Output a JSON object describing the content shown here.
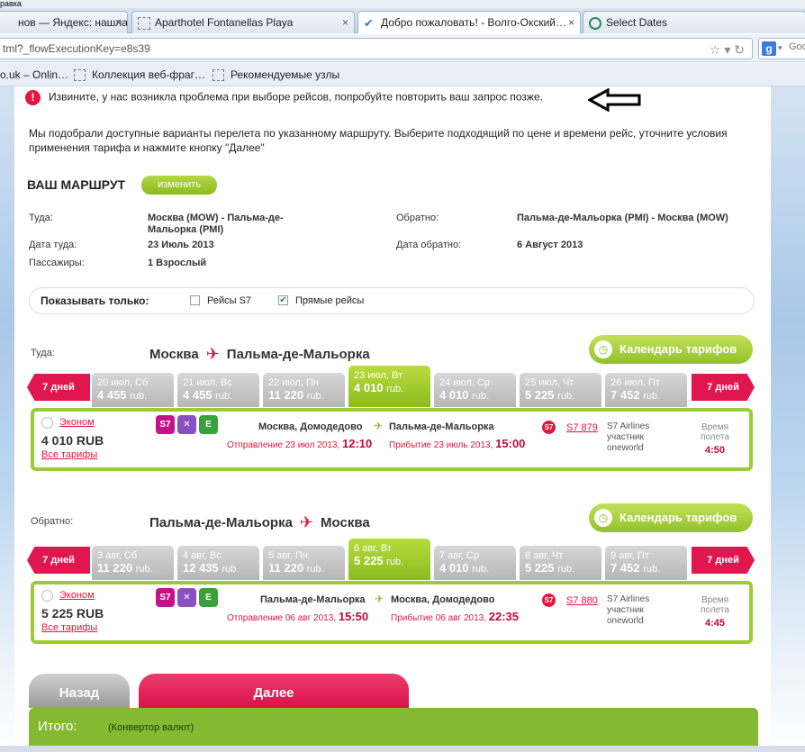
{
  "browser": {
    "menu_fragment": "равка",
    "tabs": [
      {
        "label": "нов — Яндекс: нашла…",
        "icon": "yandex-icon"
      },
      {
        "label": "Aparthotel Fontanellas Playa",
        "icon": "page-icon"
      },
      {
        "label": "Добро пожаловать! - Волго-Окский…",
        "icon": "checkmark-icon"
      },
      {
        "label": "Select Dates",
        "icon": "tripadvisor-icon"
      }
    ],
    "url": "tml?_flowExecutionKey=e8s39",
    "search_engine_label": "Goo",
    "bookmarks": [
      "o.uk – Onlin…",
      "Коллекция веб-фраг…",
      "Рекомендуемые узлы"
    ]
  },
  "page": {
    "error_message": "Извините, у нас возникла проблема при выборе рейсов, попробуйте повторить ваш запрос позже.",
    "intro": "Мы подобрали доступные варианты перелета по указанному маршруту. Выберите подходящий по цене и времени рейс, уточните условия применения тарифа и нажмите кнопку \"Далее\"",
    "route_heading": "ВАШ МАРШРУТ",
    "change_label": "изменить",
    "route": {
      "outbound_label": "Туда:",
      "outbound_value": "Москва (MOW) - Пальма-де-Мальорка (PMI)",
      "return_label": "Обратно:",
      "return_value": "Пальма-де-Мальорка (PMI) - Москва (MOW)",
      "outbound_date_label": "Дата туда:",
      "outbound_date": "23 Июль 2013",
      "return_date_label": "Дата обратно:",
      "return_date": "6 Август 2013",
      "passengers_label": "Пассажиры:",
      "passengers": "1 Взрослый"
    },
    "filter": {
      "heading": "Показывать только:",
      "s7_only": "Рейсы S7",
      "s7_checked": false,
      "direct_only": "Прямые рейсы",
      "direct_checked": true
    },
    "calendar_label": "Календарь тарифов",
    "nav_label": "7 дней",
    "outbound": {
      "section_label": "Туда:",
      "from": "Москва",
      "to": "Пальма-де-Мальорка",
      "days": [
        {
          "date": "20 июл, Сб",
          "price": "4 455",
          "cur": "rub."
        },
        {
          "date": "21 июл, Вс",
          "price": "4 455",
          "cur": "rub."
        },
        {
          "date": "22 июл, Пн",
          "price": "11 220",
          "cur": "rub."
        },
        {
          "date": "23 июл, Вт",
          "price": "4 010",
          "cur": "rub.",
          "selected": true
        },
        {
          "date": "24 июл, Ср",
          "price": "4 010",
          "cur": "rub."
        },
        {
          "date": "25 июл, Чт",
          "price": "5 225",
          "cur": "rub."
        },
        {
          "date": "26 июл, Пт",
          "price": "7 452",
          "cur": "rub."
        }
      ],
      "flight": {
        "class": "Эконом",
        "price": "4 010 RUB",
        "all_fares": "Все тарифы",
        "dep_airport": "Москва, Домодедово",
        "arr_airport": "Пальма-де-Мальорка",
        "dep_label": "Отправление 23 июл 2013,",
        "dep_time": "12:10",
        "arr_label": "Прибытие 23 июль 2013,",
        "arr_time": "15:00",
        "flight_no": "S7 879",
        "airline": "S7 Airlines",
        "member": "участник",
        "alliance": "oneworld",
        "duration_label": "Время полета",
        "duration": "4:50"
      }
    },
    "inbound": {
      "section_label": "Обратно:",
      "from": "Пальма-де-Мальорка",
      "to": "Москва",
      "days": [
        {
          "date": "3 авг, Сб",
          "price": "11 220",
          "cur": "rub."
        },
        {
          "date": "4 авг, Вс",
          "price": "12 435",
          "cur": "rub."
        },
        {
          "date": "5 авг, Пн",
          "price": "11 220",
          "cur": "rub."
        },
        {
          "date": "6 авг, Вт",
          "price": "5 225",
          "cur": "rub.",
          "selected": true
        },
        {
          "date": "7 авг, Ср",
          "price": "4 010",
          "cur": "rub."
        },
        {
          "date": "8 авг, Чт",
          "price": "5 225",
          "cur": "rub."
        },
        {
          "date": "9 авг, Пт",
          "price": "7 452",
          "cur": "rub."
        }
      ],
      "flight": {
        "class": "Эконом",
        "price": "5 225 RUB",
        "all_fares": "Все тарифы",
        "dep_airport": "Пальма-де-Мальорка",
        "arr_airport": "Москва, Домодедово",
        "dep_label": "Отправление 06 авг 2013,",
        "dep_time": "15:50",
        "arr_label": "Прибытие 06 авг 2013,",
        "arr_time": "22:35",
        "flight_no": "S7 880",
        "airline": "S7 Airlines",
        "member": "участник",
        "alliance": "oneworld",
        "duration_label": "Время полета",
        "duration": "4:45"
      }
    },
    "back_label": "Назад",
    "next_label": "Далее",
    "total_label": "Итого:",
    "converter_label": "(Конвертор валют)",
    "colors": {
      "accent_green": "#8cbb20",
      "accent_red": "#e0173e"
    }
  }
}
